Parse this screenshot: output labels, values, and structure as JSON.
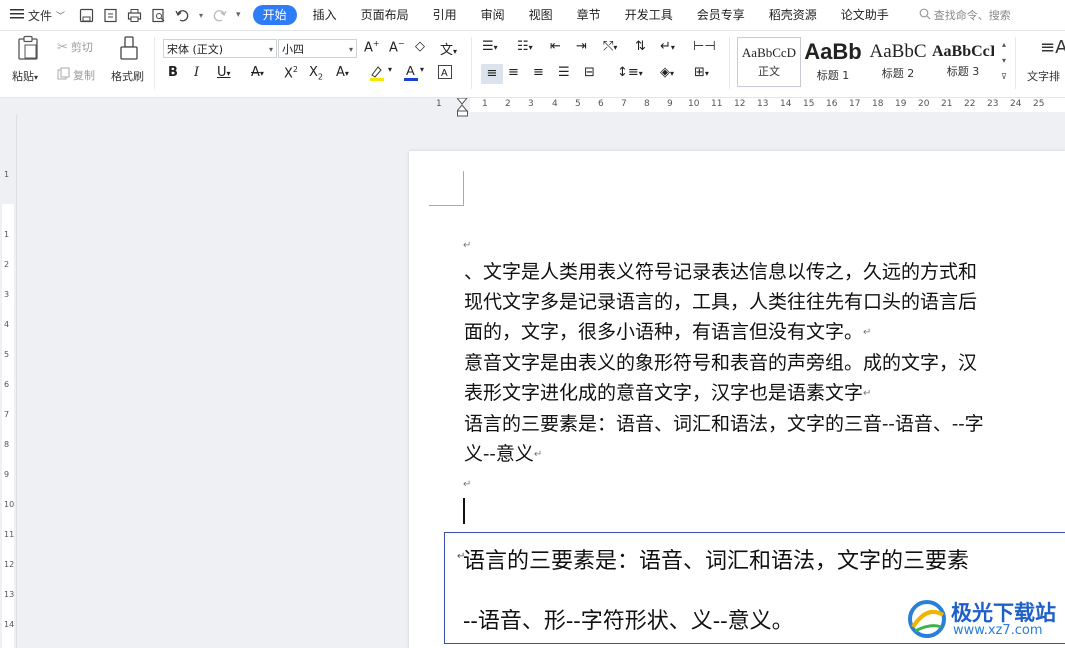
{
  "menubar": {
    "file_label": "文件",
    "tabs": [
      "开始",
      "插入",
      "页面布局",
      "引用",
      "审阅",
      "视图",
      "章节",
      "开发工具",
      "会员专享",
      "稻壳资源",
      "论文助手"
    ],
    "search_placeholder": "查找命令、搜索"
  },
  "ribbon": {
    "paste": "粘贴",
    "cut": "剪切",
    "copy": "复制",
    "format_painter": "格式刷",
    "font_name": "宋体 (正文)",
    "font_size": "小四",
    "styles": [
      {
        "sample": "AaBbCcD",
        "name": "正文"
      },
      {
        "sample": "AaBb",
        "name": "标题 1"
      },
      {
        "sample": "AaBbC",
        "name": "标题 2"
      },
      {
        "sample": "AaBbCcI",
        "name": "标题 3"
      }
    ],
    "text_layout": "文字排"
  },
  "ruler": {
    "h_numbers": [
      "1",
      "1",
      "2",
      "3",
      "4",
      "5",
      "6",
      "7",
      "8",
      "9",
      "10",
      "11",
      "12",
      "13",
      "14",
      "15",
      "16",
      "17",
      "18",
      "19",
      "20",
      "21",
      "22",
      "23",
      "24",
      "25"
    ],
    "v_numbers": [
      "1",
      "1",
      "2",
      "3",
      "4",
      "5",
      "6",
      "7",
      "8",
      "9",
      "10",
      "11",
      "12",
      "13",
      "14"
    ]
  },
  "document": {
    "lines": [
      "、文字是人类用表义符号记录表达信息以传之，久远的方式和",
      "现代文字多是记录语言的，工具，人类往往先有口头的语言后",
      "面的，文字，很多小语种，有语言但没有文字。",
      "意音文字是由表义的象形符号和表音的声旁组。成的文字，汉",
      "表形文字进化成的意音文字，汉字也是语素文字",
      "语言的三要素是：语音、词汇和语法，文字的三音--语音、--字",
      "义--意义"
    ],
    "textbox_lines": [
      "语言的三要素是：语音、词汇和语法，文字的三要素",
      "--语音、形--字符形状、义--意义。"
    ]
  },
  "watermark": {
    "title": "极光下载站",
    "url": "www.xz7.com"
  }
}
